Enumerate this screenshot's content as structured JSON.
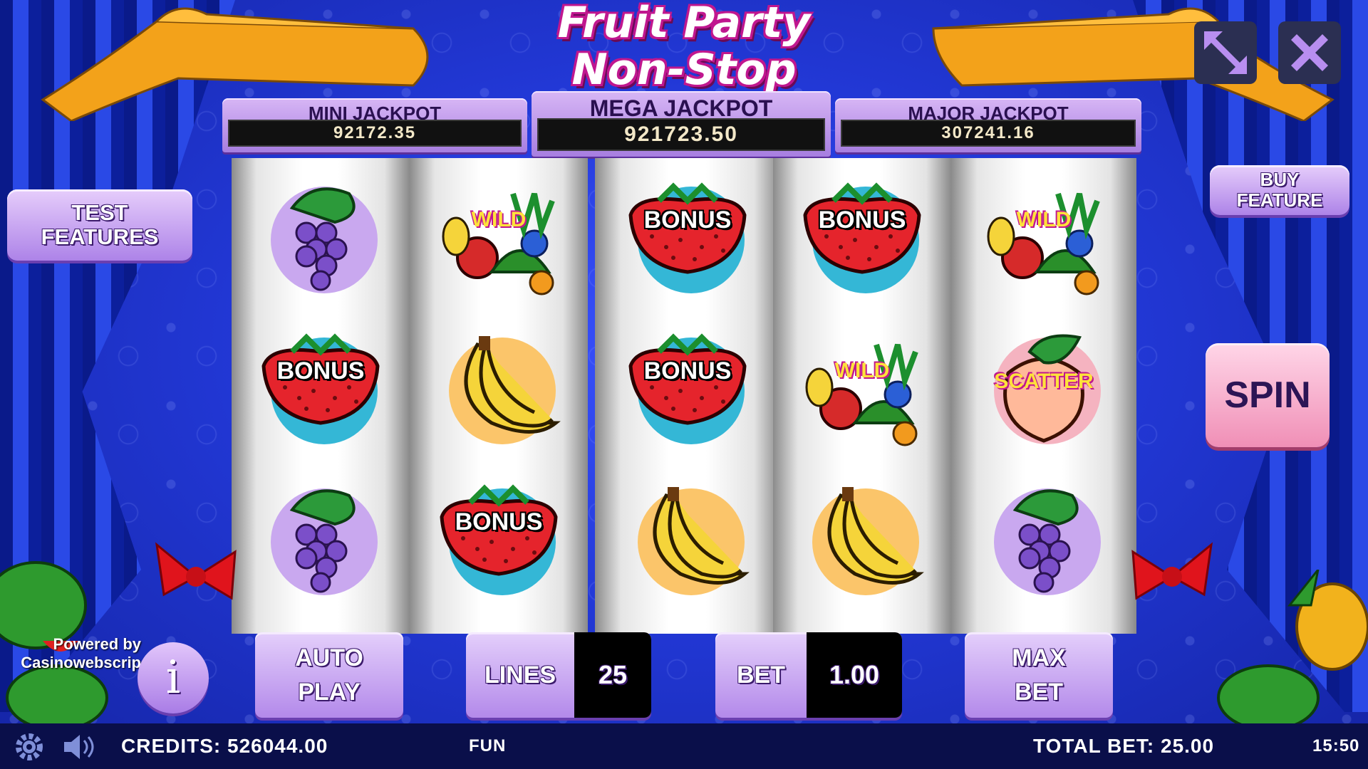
{
  "game": {
    "title_line1": "Fruit Party",
    "title_line2": "Non-Stop"
  },
  "jackpots": {
    "mini": {
      "label": "MINI JACKPOT",
      "value": "92172.35"
    },
    "mega": {
      "label": "MEGA JACKPOT",
      "value": "921723.50"
    },
    "major": {
      "label": "MAJOR JACKPOT",
      "value": "307241.16"
    }
  },
  "buttons": {
    "test_features_line1": "TEST",
    "test_features_line2": "FEATURES",
    "buy_feature_line1": "BUY",
    "buy_feature_line2": "FEATURE",
    "spin": "SPIN",
    "auto_play_line1": "AUTO",
    "auto_play_line2": "PLAY",
    "lines_label": "LINES",
    "lines_value": "25",
    "bet_label": "BET",
    "bet_value": "1.00",
    "max_bet_line1": "MAX",
    "max_bet_line2": "BET",
    "info": "i"
  },
  "branding": {
    "powered_line1": "Powered by",
    "powered_line2": "Casinowebscrip"
  },
  "status": {
    "credits": "CREDITS: 526044.00",
    "mode": "FUN",
    "total_bet": "TOTAL BET: 25.00",
    "clock": "15:50"
  },
  "reels": [
    [
      {
        "symbol": "grapes",
        "label": ""
      },
      {
        "symbol": "bonus",
        "label": "BONUS"
      },
      {
        "symbol": "grapes",
        "label": ""
      }
    ],
    [
      {
        "symbol": "wild",
        "label": "WILD"
      },
      {
        "symbol": "banana",
        "label": ""
      },
      {
        "symbol": "bonus",
        "label": "BONUS"
      }
    ],
    [
      {
        "symbol": "bonus",
        "label": "BONUS"
      },
      {
        "symbol": "bonus",
        "label": "BONUS"
      },
      {
        "symbol": "banana",
        "label": ""
      }
    ],
    [
      {
        "symbol": "bonus",
        "label": "BONUS"
      },
      {
        "symbol": "wild",
        "label": "WILD"
      },
      {
        "symbol": "banana",
        "label": ""
      }
    ],
    [
      {
        "symbol": "wild",
        "label": "WILD"
      },
      {
        "symbol": "scatter",
        "label": "SCATTER"
      },
      {
        "symbol": "grapes",
        "label": ""
      }
    ]
  ],
  "icons": {
    "fullscreen": "fullscreen-icon",
    "close": "close-icon",
    "settings": "gear-icon",
    "sound": "speaker-icon"
  }
}
